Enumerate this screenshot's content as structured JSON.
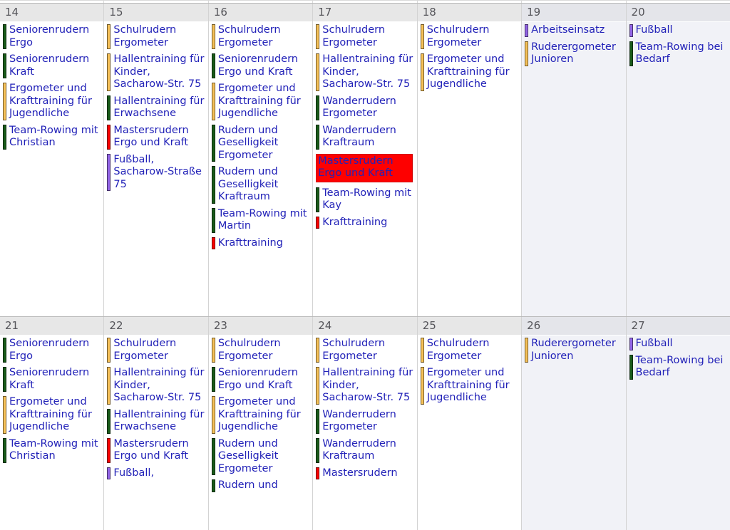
{
  "view": {
    "type": "month-grid",
    "category_colors": {
      "green": "#1a5c1a",
      "orange": "#f8c35a",
      "red": "#fe0000",
      "purple": "#9466e8"
    },
    "selected_background": "#fe0000",
    "selected_border": "#d00000",
    "event_text_color": "#2222b8",
    "day_number_color": "#55555a",
    "day_header_background": "#e7e7e7",
    "weekend_background": "#f1f2f7"
  },
  "weeks": [
    {
      "days": [
        {
          "number": "14",
          "weekend": false,
          "events": [
            {
              "title": "Seniorenrudern Ergo",
              "color": "green",
              "selected": false
            },
            {
              "title": "Seniorenrudern Kraft",
              "color": "green",
              "selected": false
            },
            {
              "title": "Ergometer und Krafttraining für Jugendliche",
              "color": "orange",
              "selected": false
            },
            {
              "title": "Team-Rowing mit Christian",
              "color": "green",
              "selected": false
            }
          ]
        },
        {
          "number": "15",
          "weekend": false,
          "events": [
            {
              "title": "Schulrudern Ergometer",
              "color": "orange",
              "selected": false
            },
            {
              "title": "Hallentraining für Kinder, Sacharow-Str. 75",
              "color": "orange",
              "selected": false
            },
            {
              "title": "Hallentraining für Erwachsene",
              "color": "green",
              "selected": false
            },
            {
              "title": "Mastersrudern Ergo und Kraft",
              "color": "red",
              "selected": false
            },
            {
              "title": "Fußball, Sacharow-Straße 75",
              "color": "purple",
              "selected": false
            }
          ]
        },
        {
          "number": "16",
          "weekend": false,
          "events": [
            {
              "title": "Schulrudern Ergometer",
              "color": "orange",
              "selected": false
            },
            {
              "title": "Seniorenrudern Ergo und Kraft",
              "color": "green",
              "selected": false
            },
            {
              "title": "Ergometer und Krafttraining für Jugendliche",
              "color": "orange",
              "selected": false
            },
            {
              "title": "Rudern und Geselligkeit Ergometer",
              "color": "green",
              "selected": false
            },
            {
              "title": "Rudern und Geselligkeit Kraftraum",
              "color": "green",
              "selected": false
            },
            {
              "title": "Team-Rowing mit Martin",
              "color": "green",
              "selected": false
            },
            {
              "title": "Krafttraining",
              "color": "red",
              "selected": false
            }
          ]
        },
        {
          "number": "17",
          "weekend": false,
          "events": [
            {
              "title": "Schulrudern Ergometer",
              "color": "orange",
              "selected": false
            },
            {
              "title": "Hallentraining für Kinder, Sacharow-Str. 75",
              "color": "orange",
              "selected": false
            },
            {
              "title": "Wanderrudern Ergometer",
              "color": "green",
              "selected": false
            },
            {
              "title": "Wanderrudern Kraftraum",
              "color": "green",
              "selected": false
            },
            {
              "title": "Mastersrudern Ergo und Kraft",
              "color": "red",
              "selected": true
            },
            {
              "title": "Team-Rowing mit Kay",
              "color": "green",
              "selected": false
            },
            {
              "title": "Krafttraining",
              "color": "red",
              "selected": false
            }
          ]
        },
        {
          "number": "18",
          "weekend": false,
          "events": [
            {
              "title": "Schulrudern Ergometer",
              "color": "orange",
              "selected": false
            },
            {
              "title": "Ergometer und Krafttraining für Jugendliche",
              "color": "orange",
              "selected": false
            }
          ]
        },
        {
          "number": "19",
          "weekend": true,
          "events": [
            {
              "title": "Arbeitseinsatz",
              "color": "purple",
              "selected": false
            },
            {
              "title": "Ruderergometer Junioren",
              "color": "orange",
              "selected": false
            }
          ]
        },
        {
          "number": "20",
          "weekend": true,
          "events": [
            {
              "title": "Fußball",
              "color": "purple",
              "selected": false
            },
            {
              "title": "Team-Rowing bei Bedarf",
              "color": "green",
              "selected": false
            }
          ]
        }
      ]
    },
    {
      "days": [
        {
          "number": "21",
          "weekend": false,
          "events": [
            {
              "title": "Seniorenrudern Ergo",
              "color": "green",
              "selected": false
            },
            {
              "title": "Seniorenrudern Kraft",
              "color": "green",
              "selected": false
            },
            {
              "title": "Ergometer und Krafttraining für Jugendliche",
              "color": "orange",
              "selected": false
            },
            {
              "title": "Team-Rowing mit Christian",
              "color": "green",
              "selected": false
            }
          ]
        },
        {
          "number": "22",
          "weekend": false,
          "events": [
            {
              "title": "Schulrudern Ergometer",
              "color": "orange",
              "selected": false
            },
            {
              "title": "Hallentraining für Kinder, Sacharow-Str. 75",
              "color": "orange",
              "selected": false
            },
            {
              "title": "Hallentraining für Erwachsene",
              "color": "green",
              "selected": false
            },
            {
              "title": "Mastersrudern Ergo und Kraft",
              "color": "red",
              "selected": false
            },
            {
              "title": "Fußball,",
              "color": "purple",
              "selected": false
            }
          ]
        },
        {
          "number": "23",
          "weekend": false,
          "events": [
            {
              "title": "Schulrudern Ergometer",
              "color": "orange",
              "selected": false
            },
            {
              "title": "Seniorenrudern Ergo und Kraft",
              "color": "green",
              "selected": false
            },
            {
              "title": "Ergometer und Krafttraining für Jugendliche",
              "color": "orange",
              "selected": false
            },
            {
              "title": "Rudern und Geselligkeit Ergometer",
              "color": "green",
              "selected": false
            },
            {
              "title": "Rudern und",
              "color": "green",
              "selected": false
            }
          ]
        },
        {
          "number": "24",
          "weekend": false,
          "events": [
            {
              "title": "Schulrudern Ergometer",
              "color": "orange",
              "selected": false
            },
            {
              "title": "Hallentraining für Kinder, Sacharow-Str. 75",
              "color": "orange",
              "selected": false
            },
            {
              "title": "Wanderrudern Ergometer",
              "color": "green",
              "selected": false
            },
            {
              "title": "Wanderrudern Kraftraum",
              "color": "green",
              "selected": false
            },
            {
              "title": "Mastersrudern",
              "color": "red",
              "selected": false
            }
          ]
        },
        {
          "number": "25",
          "weekend": false,
          "events": [
            {
              "title": "Schulrudern Ergometer",
              "color": "orange",
              "selected": false
            },
            {
              "title": "Ergometer und Krafttraining für Jugendliche",
              "color": "orange",
              "selected": false
            }
          ]
        },
        {
          "number": "26",
          "weekend": true,
          "events": [
            {
              "title": "Ruderergometer Junioren",
              "color": "orange",
              "selected": false
            }
          ]
        },
        {
          "number": "27",
          "weekend": true,
          "events": [
            {
              "title": "Fußball",
              "color": "purple",
              "selected": false
            },
            {
              "title": "Team-Rowing bei Bedarf",
              "color": "green",
              "selected": false
            }
          ]
        }
      ]
    }
  ]
}
